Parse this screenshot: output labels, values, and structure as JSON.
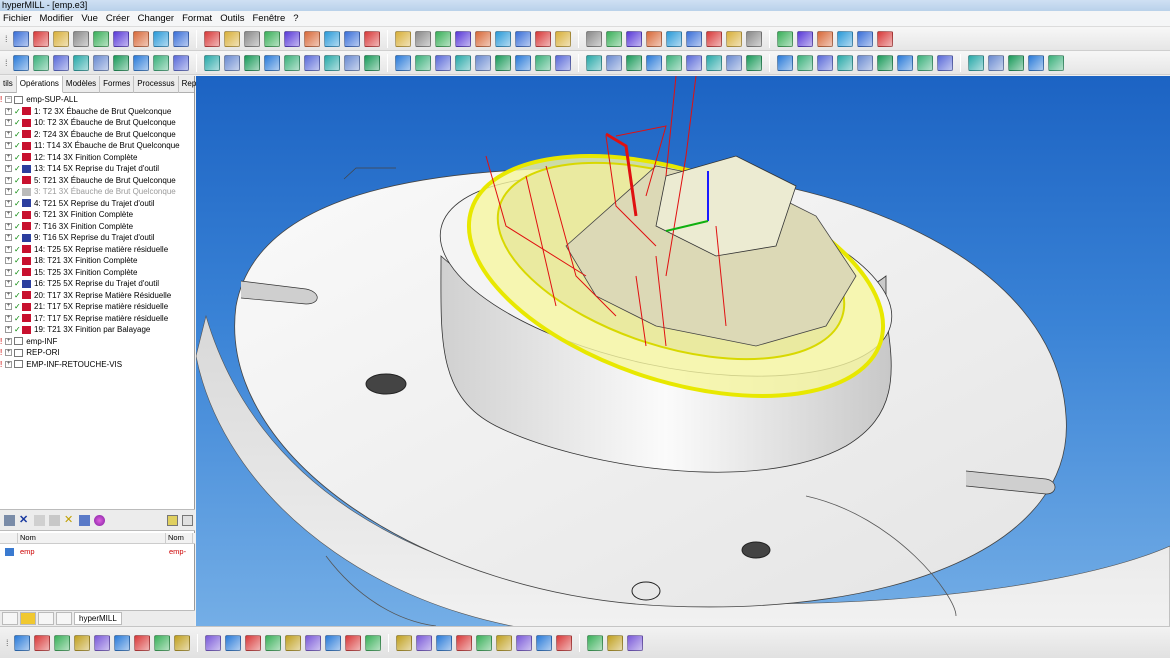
{
  "window": {
    "title": "hyperMILL - [emp.e3]"
  },
  "menu": [
    "Fichier",
    "Modifier",
    "Vue",
    "Créer",
    "Changer",
    "Format",
    "Outils",
    "Fenêtre",
    "?"
  ],
  "panel_tabs": [
    "tils",
    "Opérations",
    "Modèles",
    "Formes",
    "Processus",
    "Repères"
  ],
  "tree": {
    "roots": [
      {
        "label": "emp-SUP-ALL",
        "items": [
          {
            "label": "1: T2 3X Ébauche de Brut Quelconque",
            "icon": "roughing-icon",
            "color": "#c8102e",
            "disabled": false
          },
          {
            "label": "10: T2 3X Ébauche de Brut Quelconque",
            "icon": "roughing-icon",
            "color": "#c8102e",
            "disabled": false
          },
          {
            "label": "2: T24 3X Ébauche de Brut Quelconque",
            "icon": "roughing-icon",
            "color": "#c8102e",
            "disabled": false
          },
          {
            "label": "11: T14 3X Ébauche de Brut Quelconque",
            "icon": "roughing-icon",
            "color": "#c8102e",
            "disabled": false
          },
          {
            "label": "12: T14 3X Finition Complète",
            "icon": "finishing-icon",
            "color": "#c8102e",
            "disabled": false
          },
          {
            "label": "13: T14 5X Reprise du Trajet d'outil",
            "icon": "rework-icon",
            "color": "#2c3e9e",
            "disabled": false
          },
          {
            "label": "5: T21 3X Ébauche de Brut Quelconque",
            "icon": "roughing-icon",
            "color": "#c8102e",
            "disabled": false
          },
          {
            "label": "3: T21 3X Ébauche de Brut Quelconque",
            "icon": "roughing-icon",
            "color": "#bbbbbb",
            "disabled": true
          },
          {
            "label": "4: T21 5X Reprise du Trajet d'outil",
            "icon": "rework-icon",
            "color": "#2c3e9e",
            "disabled": false
          },
          {
            "label": "6: T21 3X Finition Complète",
            "icon": "finishing-icon",
            "color": "#c8102e",
            "disabled": false
          },
          {
            "label": "7: T16 3X Finition Complète",
            "icon": "finishing-icon",
            "color": "#c8102e",
            "disabled": false
          },
          {
            "label": "9: T16 5X Reprise du Trajet d'outil",
            "icon": "rework-icon",
            "color": "#2c3e9e",
            "disabled": false
          },
          {
            "label": "14: T25 5X Reprise matière résiduelle",
            "icon": "residual-icon",
            "color": "#c8102e",
            "disabled": false
          },
          {
            "label": "18: T21 3X Finition Complète",
            "icon": "finishing-icon",
            "color": "#c8102e",
            "disabled": false
          },
          {
            "label": "15: T25 3X Finition Complète",
            "icon": "finishing-icon",
            "color": "#c8102e",
            "disabled": false
          },
          {
            "label": "16: T25 5X Reprise du Trajet d'outil",
            "icon": "rework-icon",
            "color": "#2c3e9e",
            "disabled": false
          },
          {
            "label": "20: T17 3X Reprise Matière Résiduelle",
            "icon": "residual-icon",
            "color": "#c8102e",
            "disabled": false
          },
          {
            "label": "21: T17 5X Reprise matière résiduelle",
            "icon": "residual-icon",
            "color": "#c8102e",
            "disabled": false
          },
          {
            "label": "17: T17 5X Reprise matière résiduelle",
            "icon": "residual-icon",
            "color": "#c8102e",
            "disabled": false
          },
          {
            "label": "19: T21 3X Finition par Balayage",
            "icon": "sweep-icon",
            "color": "#c8102e",
            "disabled": false
          }
        ]
      },
      {
        "label": "emp-INF",
        "items": []
      },
      {
        "label": "REP-ORI",
        "items": []
      },
      {
        "label": "EMP-INF-RETOUCHE-VIS",
        "items": []
      }
    ]
  },
  "object_list": {
    "columns": [
      "Nom",
      "Nom"
    ],
    "rows": [
      {
        "name": "emp",
        "name2": "emp-"
      }
    ]
  },
  "bottom_tab": "hyperMILL",
  "colors": {
    "viewport_top": "#1c63c3",
    "viewport_bottom": "#74aee6",
    "toolpath_yellow": "#e8e800",
    "toolpath_red": "#e01010",
    "tree_error": "#c00000"
  }
}
